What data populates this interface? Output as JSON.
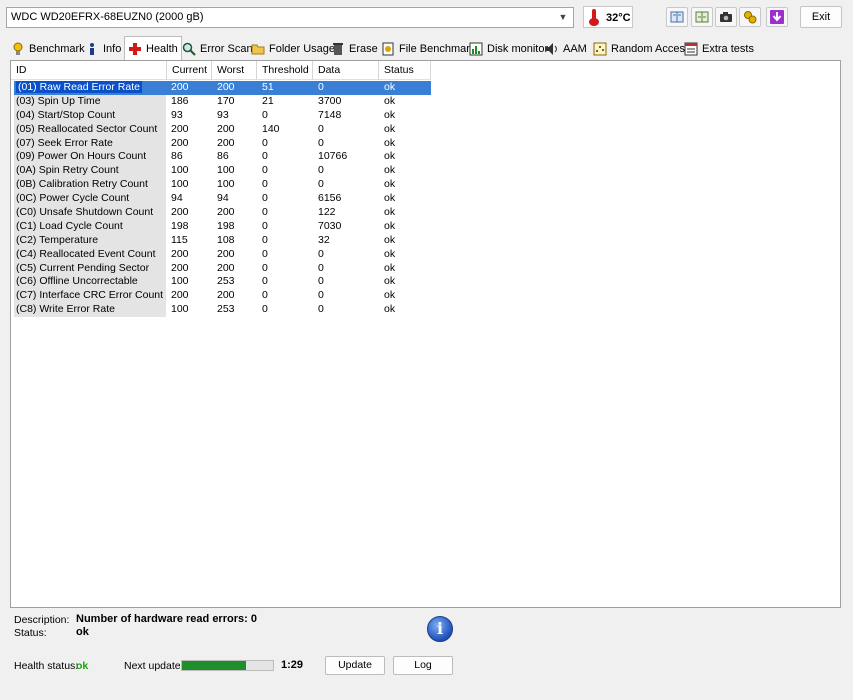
{
  "drive": {
    "selected": "WDC WD20EFRX-68EUZN0 (2000 gB)",
    "chevron": "chevron-down-icon"
  },
  "temperature": {
    "value": "32°C",
    "icon": "thermometer-icon"
  },
  "toolbar": {
    "buttons": [
      "copy-info-icon",
      "copy-text-icon",
      "screenshot-icon",
      "options-icon",
      "download-icon"
    ],
    "exit_label": "Exit"
  },
  "tabs": [
    {
      "label": "Benchmark",
      "icon": "benchmark-icon"
    },
    {
      "label": "Info",
      "icon": "info-icon"
    },
    {
      "label": "Health",
      "icon": "health-cross-icon"
    },
    {
      "label": "Error Scan",
      "icon": "magnifier-icon"
    },
    {
      "label": "Folder Usage",
      "icon": "folder-icon"
    },
    {
      "label": "Erase",
      "icon": "trash-icon"
    },
    {
      "label": "File Benchmark",
      "icon": "file-benchmark-icon"
    },
    {
      "label": "Disk monitor",
      "icon": "disk-monitor-icon"
    },
    {
      "label": "AAM",
      "icon": "speaker-icon"
    },
    {
      "label": "Random Access",
      "icon": "random-access-icon"
    },
    {
      "label": "Extra tests",
      "icon": "extra-tests-icon"
    }
  ],
  "table": {
    "headers": [
      "ID",
      "Current",
      "Worst",
      "Threshold",
      "Data",
      "Status"
    ],
    "rows": [
      {
        "id": "(01) Raw Read Error Rate",
        "current": "200",
        "worst": "200",
        "threshold": "51",
        "data": "0",
        "status": "ok"
      },
      {
        "id": "(03) Spin Up Time",
        "current": "186",
        "worst": "170",
        "threshold": "21",
        "data": "3700",
        "status": "ok"
      },
      {
        "id": "(04) Start/Stop Count",
        "current": "93",
        "worst": "93",
        "threshold": "0",
        "data": "7148",
        "status": "ok"
      },
      {
        "id": "(05) Reallocated Sector Count",
        "current": "200",
        "worst": "200",
        "threshold": "140",
        "data": "0",
        "status": "ok"
      },
      {
        "id": "(07) Seek Error Rate",
        "current": "200",
        "worst": "200",
        "threshold": "0",
        "data": "0",
        "status": "ok"
      },
      {
        "id": "(09) Power On Hours Count",
        "current": "86",
        "worst": "86",
        "threshold": "0",
        "data": "10766",
        "status": "ok"
      },
      {
        "id": "(0A) Spin Retry Count",
        "current": "100",
        "worst": "100",
        "threshold": "0",
        "data": "0",
        "status": "ok"
      },
      {
        "id": "(0B) Calibration Retry Count",
        "current": "100",
        "worst": "100",
        "threshold": "0",
        "data": "0",
        "status": "ok"
      },
      {
        "id": "(0C) Power Cycle Count",
        "current": "94",
        "worst": "94",
        "threshold": "0",
        "data": "6156",
        "status": "ok"
      },
      {
        "id": "(C0) Unsafe Shutdown Count",
        "current": "200",
        "worst": "200",
        "threshold": "0",
        "data": "122",
        "status": "ok"
      },
      {
        "id": "(C1) Load Cycle Count",
        "current": "198",
        "worst": "198",
        "threshold": "0",
        "data": "7030",
        "status": "ok"
      },
      {
        "id": "(C2) Temperature",
        "current": "115",
        "worst": "108",
        "threshold": "0",
        "data": "32",
        "status": "ok"
      },
      {
        "id": "(C4) Reallocated Event Count",
        "current": "200",
        "worst": "200",
        "threshold": "0",
        "data": "0",
        "status": "ok"
      },
      {
        "id": "(C5) Current Pending Sector",
        "current": "200",
        "worst": "200",
        "threshold": "0",
        "data": "0",
        "status": "ok"
      },
      {
        "id": "(C6) Offline Uncorrectable",
        "current": "100",
        "worst": "253",
        "threshold": "0",
        "data": "0",
        "status": "ok"
      },
      {
        "id": "(C7) Interface CRC Error Count",
        "current": "200",
        "worst": "200",
        "threshold": "0",
        "data": "0",
        "status": "ok"
      },
      {
        "id": "(C8) Write Error Rate",
        "current": "100",
        "worst": "253",
        "threshold": "0",
        "data": "0",
        "status": "ok"
      }
    ]
  },
  "bottom": {
    "description_label": "Description:",
    "description_value": "Number of hardware read errors: 0",
    "status_label": "Status:",
    "status_value": "ok",
    "health_label": "Health status:",
    "health_value": "ok",
    "next_update_label": "Next update:",
    "next_update_progress": 0.7,
    "countdown": "1:29",
    "update_label": "Update",
    "log_label": "Log",
    "info_glyph": "i"
  },
  "colors": {
    "selection": "#3a7fd6",
    "health_ok": "#14a30f",
    "progress": "#1f8f2a",
    "thermometer": "#d21a1a"
  }
}
